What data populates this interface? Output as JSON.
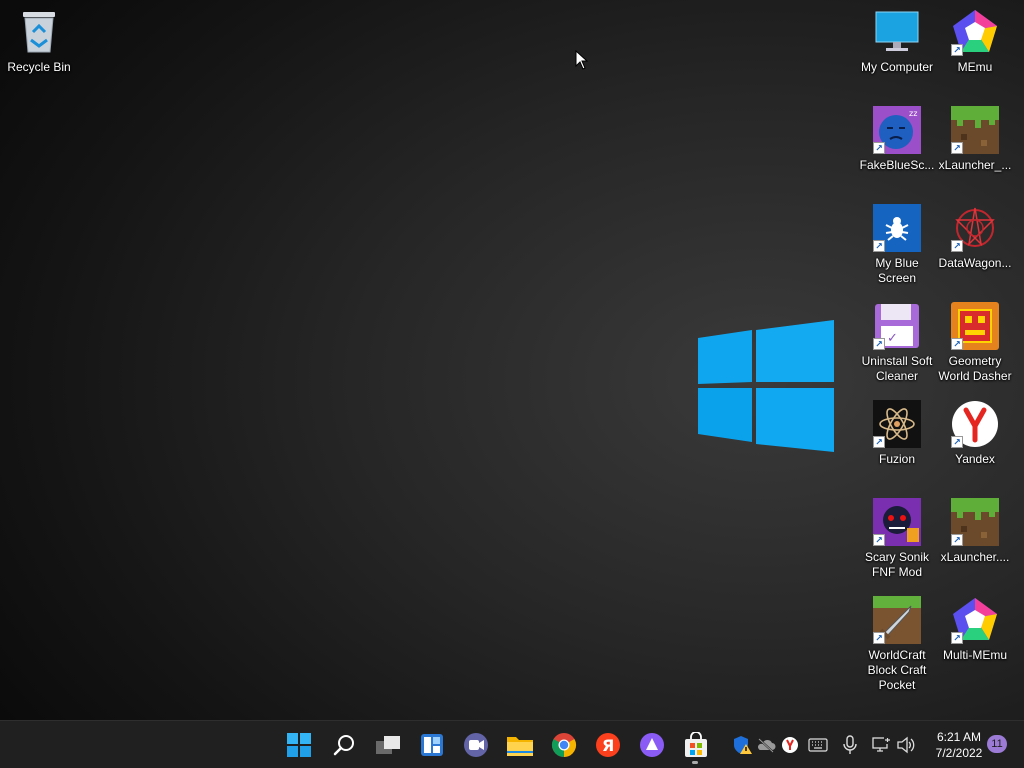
{
  "desktop": {
    "left_icons": [
      {
        "label": "Recycle Bin"
      }
    ],
    "right_icons": [
      {
        "label": "My Computer"
      },
      {
        "label": "MEmu"
      },
      {
        "label": "FakeBlueSc..."
      },
      {
        "label": "xLauncher_..."
      },
      {
        "label": "My Blue Screen"
      },
      {
        "label": "DataWagon..."
      },
      {
        "label": "Uninstall Soft Cleaner"
      },
      {
        "label": "Geometry World Dasher"
      },
      {
        "label": "Fuzion"
      },
      {
        "label": "Yandex"
      },
      {
        "label": "Scary Sonik FNF Mod"
      },
      {
        "label": "xLauncher...."
      },
      {
        "label": "WorldCraft Block Craft Pocket"
      },
      {
        "label": "Multi-MEmu"
      }
    ]
  },
  "taskbar": {
    "apps": [
      "windows-start-icon",
      "search-icon",
      "task-view-icon",
      "widgets-icon",
      "teams-chat-icon",
      "file-explorer-icon",
      "chrome-icon",
      "yandex-browser-icon",
      "alice-icon",
      "microsoft-store-icon"
    ],
    "tray": [
      "defender-warning-icon",
      "onedrive-offline-icon",
      "yandex-tray-icon",
      "keyboard-icon",
      "microphone-icon",
      "network-icon",
      "volume-icon"
    ],
    "clock": {
      "time": "6:21 AM",
      "date": "7/2/2022"
    },
    "notification_count": "11"
  },
  "colors": {
    "win_blue": "#00a4ef",
    "taskbar_bg": "#202020",
    "badge": "#9c7bd6"
  }
}
